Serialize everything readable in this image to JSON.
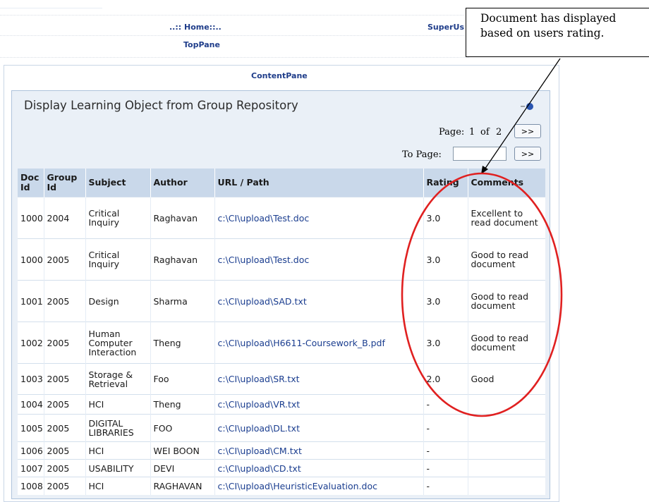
{
  "nav": {
    "home": "..:: Home::..",
    "superuser": "SuperUs"
  },
  "panes": {
    "top": "TopPane",
    "content": "ContentPane"
  },
  "callout": {
    "line1": "Document has displayed",
    "line2": "based on users rating."
  },
  "module": {
    "title": "Display Learning Object from Group Repository"
  },
  "pager": {
    "page_label": "Page:",
    "current": "1",
    "of_label": "of",
    "total": "2",
    "next_label": ">>",
    "to_page_label": "To Page:",
    "to_page_value": "",
    "go_label": ">>"
  },
  "table": {
    "headers": [
      "Doc Id",
      "Group Id",
      "Subject",
      "Author",
      "URL / Path",
      "Rating",
      "Comments"
    ],
    "rows": [
      [
        "1000",
        "2004",
        "Critical Inquiry",
        "Raghavan",
        "c:\\CI\\upload\\Test.doc",
        "3.0",
        "Excellent to read document"
      ],
      [
        "1000",
        "2005",
        "Critical Inquiry",
        "Raghavan",
        "c:\\CI\\upload\\Test.doc",
        "3.0",
        "Good to read document"
      ],
      [
        "1001",
        "2005",
        "Design",
        "Sharma",
        "c:\\CI\\upload\\SAD.txt",
        "3.0",
        "Good to read document"
      ],
      [
        "1002",
        "2005",
        "Human Computer Interaction",
        "Theng",
        "c:\\CI\\upload\\H6611-Coursework_B.pdf",
        "3.0",
        "Good to read document"
      ],
      [
        "1003",
        "2005",
        "Storage & Retrieval",
        "Foo",
        "c:\\CI\\upload\\SR.txt",
        "2.0",
        "Good"
      ],
      [
        "1004",
        "2005",
        "HCI",
        "Theng",
        "c:\\CI\\upload\\VR.txt",
        "-",
        ""
      ],
      [
        "1005",
        "2005",
        "DIGITAL LIBRARIES",
        "FOO",
        "c:\\CI\\upload\\DL.txt",
        "-",
        ""
      ],
      [
        "1006",
        "2005",
        "HCI",
        "WEI BOON",
        "c:\\CI\\upload\\CM.txt",
        "-",
        ""
      ],
      [
        "1007",
        "2005",
        "USABILITY",
        "DEVI",
        "c:\\CI\\upload\\CD.txt",
        "-",
        ""
      ],
      [
        "1008",
        "2005",
        "HCI",
        "RAGHAVAN",
        "c:\\CI\\upload\\HeuristicEvaluation.doc",
        "-",
        ""
      ]
    ]
  },
  "colors": {
    "link": "#1a3d8f",
    "header_bg": "#c9d8ea",
    "annotation": "#e02020"
  },
  "icons": {
    "module_controls": [
      "minimize-icon",
      "help-icon"
    ]
  }
}
